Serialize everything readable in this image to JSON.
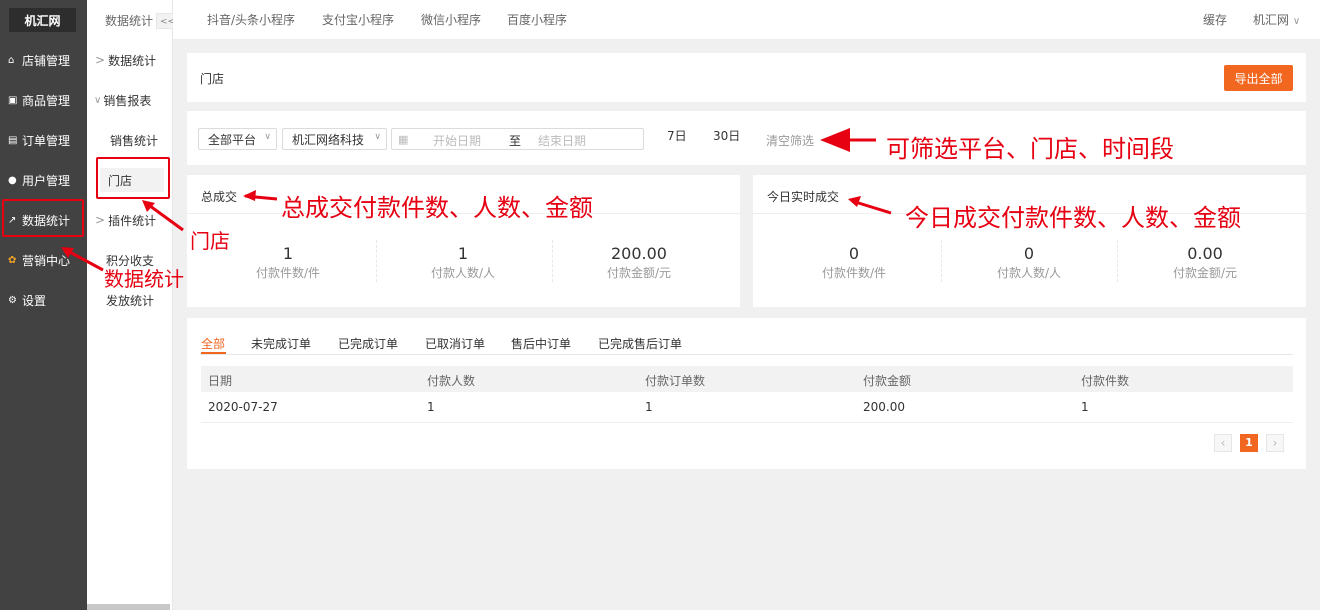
{
  "app": {
    "logo": "机汇网"
  },
  "sidebar": {
    "items": [
      {
        "label": "店铺管理",
        "icon": "home-icon"
      },
      {
        "label": "商品管理",
        "icon": "goods-icon"
      },
      {
        "label": "订单管理",
        "icon": "order-icon"
      },
      {
        "label": "用户管理",
        "icon": "user-icon"
      },
      {
        "label": "数据统计",
        "icon": "chart-icon"
      },
      {
        "label": "营销中心",
        "icon": "marketing-icon"
      },
      {
        "label": "设置",
        "icon": "gear-icon"
      }
    ]
  },
  "subnav": {
    "title": "数据统计",
    "collapse": "<<",
    "items": [
      {
        "label": "数据统计",
        "expander": ">"
      },
      {
        "label": "销售报表",
        "expander": "∨"
      },
      {
        "label": "销售统计",
        "expander": ""
      },
      {
        "label": "门店",
        "expander": ""
      },
      {
        "label": "插件统计",
        "expander": ">"
      },
      {
        "label": "积分收支",
        "expander": ""
      },
      {
        "label": "发放统计",
        "expander": ""
      }
    ]
  },
  "topbar": {
    "tabs": [
      "抖音/头条小程序",
      "支付宝小程序",
      "微信小程序",
      "百度小程序"
    ],
    "cache": "缓存",
    "account": "机汇网",
    "account_caret": "∨"
  },
  "page": {
    "title": "门店",
    "export_label": "导出全部"
  },
  "filters": {
    "platform": "全部平台",
    "store": "机汇网络科技",
    "start_placeholder": "开始日期",
    "range_sep": "至",
    "end_placeholder": "结束日期",
    "days7": "7日",
    "days30": "30日",
    "clear": "清空筛选"
  },
  "totals": {
    "title": "总成交",
    "stats": [
      {
        "value": "1",
        "label": "付款件数/件"
      },
      {
        "value": "1",
        "label": "付款人数/人"
      },
      {
        "value": "200.00",
        "label": "付款金额/元"
      }
    ]
  },
  "today": {
    "title": "今日实时成交",
    "stats": [
      {
        "value": "0",
        "label": "付款件数/件"
      },
      {
        "value": "0",
        "label": "付款人数/人"
      },
      {
        "value": "0.00",
        "label": "付款金额/元"
      }
    ]
  },
  "orders": {
    "tabs": [
      "全部",
      "未完成订单",
      "已完成订单",
      "已取消订单",
      "售后中订单",
      "已完成售后订单"
    ],
    "active_tab": 0,
    "columns": [
      "日期",
      "付款人数",
      "付款订单数",
      "付款金额",
      "付款件数"
    ],
    "rows": [
      [
        "2020-07-27",
        "1",
        "1",
        "200.00",
        "1"
      ]
    ],
    "pagination": {
      "prev": "‹",
      "current": "1",
      "next": "›"
    }
  },
  "annotations": {
    "filter_note": "可筛选平台、门店、时间段",
    "total_note": "总成交付款件数、人数、金额",
    "today_note": "今日成交付款件数、人数、金额",
    "store_note": "门店",
    "stats_note": "数据统计"
  },
  "colors": {
    "accent": "#f2671f",
    "annotation": "#e60012",
    "sidebar": "#424242"
  }
}
